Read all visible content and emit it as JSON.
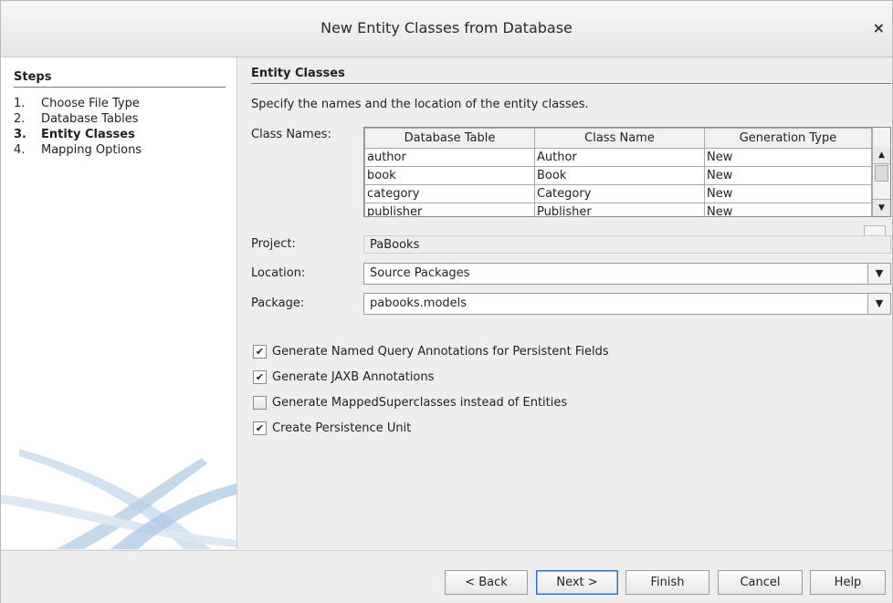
{
  "window": {
    "title": "New Entity Classes from Database",
    "close_glyph": "×"
  },
  "steps": {
    "heading": "Steps",
    "items": [
      {
        "num": "1.",
        "label": "Choose File Type",
        "active": false
      },
      {
        "num": "2.",
        "label": "Database Tables",
        "active": false
      },
      {
        "num": "3.",
        "label": "Entity Classes",
        "active": true
      },
      {
        "num": "4.",
        "label": "Mapping Options",
        "active": false
      }
    ]
  },
  "panel": {
    "title": "Entity Classes",
    "description": "Specify the names and the location of the entity classes.",
    "class_names_label": "Class Names:",
    "table": {
      "headers": [
        "Database Table",
        "Class Name",
        "Generation Type"
      ],
      "rows": [
        [
          "author",
          "Author",
          "New"
        ],
        [
          "book",
          "Book",
          "New"
        ],
        [
          "category",
          "Category",
          "New"
        ],
        [
          "publisher",
          "Publisher",
          "New"
        ]
      ]
    },
    "ellipsis_label": "...",
    "project_label": "Project:",
    "project_value": "PaBooks",
    "location_label": "Location:",
    "location_value": "Source Packages",
    "package_label": "Package:",
    "package_value": "pabooks.models",
    "checkboxes": [
      {
        "label": "Generate Named Query Annotations for Persistent Fields",
        "checked": true
      },
      {
        "label": "Generate JAXB Annotations",
        "checked": true
      },
      {
        "label": "Generate MappedSuperclasses instead of Entities",
        "checked": false
      },
      {
        "label": "Create Persistence Unit",
        "checked": true
      }
    ]
  },
  "buttons": {
    "back": "< Back",
    "next": "Next >",
    "finish": "Finish",
    "cancel": "Cancel",
    "help": "Help"
  },
  "colors": {
    "default_button_border": "#2f6fb7",
    "swoosh": "#bcd3e8"
  },
  "icons": {
    "check": "✔",
    "arrow_down": "▼",
    "arrow_up": "▲"
  }
}
